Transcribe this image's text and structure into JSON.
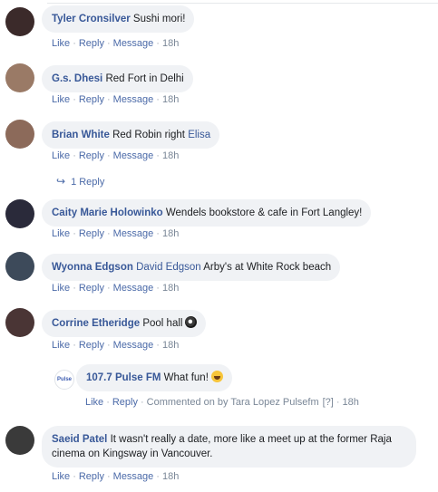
{
  "actions": {
    "like": "Like",
    "reply": "Reply",
    "message": "Message",
    "sep": "·"
  },
  "comments": [
    {
      "name": "Tyler Cronsilver",
      "text": "Sushi mori!",
      "time": "18h",
      "avatar_color": "#3b2a2a"
    },
    {
      "name": "G.s. Dhesi",
      "text": "Red Fort in Delhi",
      "time": "18h",
      "avatar_color": "#9a7a66"
    },
    {
      "name": "Brian White",
      "text": "Red Robin right",
      "tag": "Elisa",
      "time": "18h",
      "avatar_color": "#8c6a5a"
    },
    {
      "name": "Caity Marie Holowinko",
      "text": "Wendels bookstore & cafe in Fort Langley!",
      "time": "18h",
      "avatar_color": "#2a2a3a"
    },
    {
      "name": "Wyonna Edgson",
      "tag": "David Edgson",
      "text": "Arby's at White Rock beach",
      "time": "18h",
      "avatar_color": "#3d4a5a"
    },
    {
      "name": "Corrine Etheridge",
      "text": "Pool hall",
      "time": "18h",
      "avatar_color": "#4a3535",
      "emoji": "pool-ball-icon"
    },
    {
      "name": "Saeid Patel",
      "text": "It wasn't really a date, more like a meet up at the former Raja cinema on Kingsway in Vancouver.",
      "time": "18h",
      "avatar_color": "#3a3a3a"
    }
  ],
  "reply_count": "1 Reply",
  "page_reply": {
    "name": "107.7 Pulse FM",
    "text": "What fun!",
    "emoji": "grinning-face-icon",
    "avatar_text": "Pulse",
    "comment_meta": "Commented on by Tara Lopez Pulsefm",
    "edit_marker": "[?]",
    "time": "18h"
  },
  "colors": {
    "name": "#385898",
    "bubble": "#f0f2f5",
    "action": "#4b6aa8",
    "meta": "#7a8797"
  }
}
